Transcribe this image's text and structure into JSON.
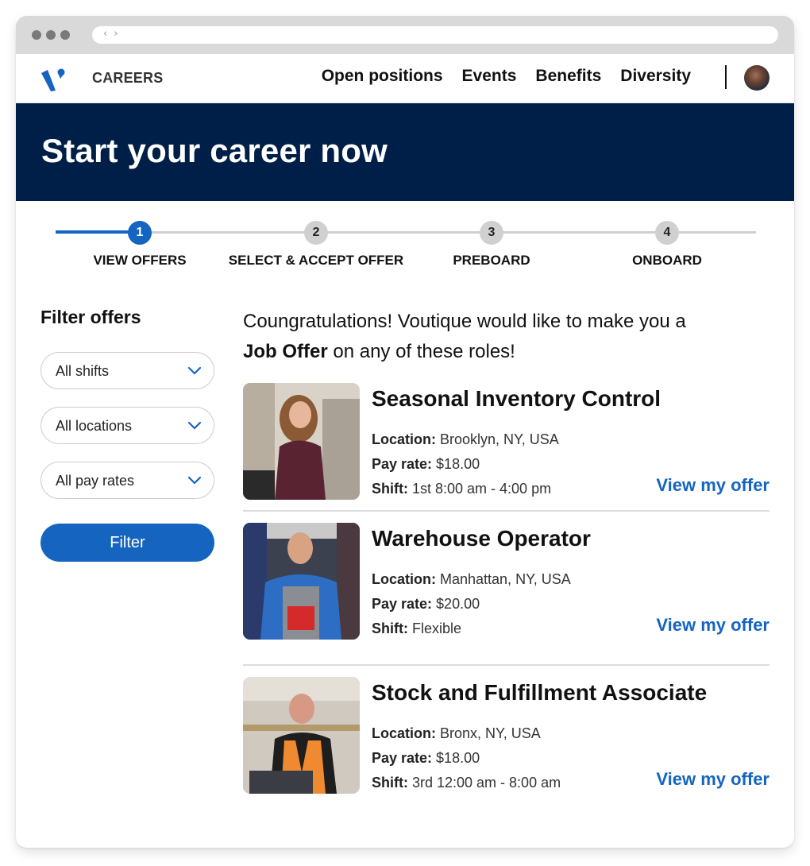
{
  "browser": {
    "nav_arrows": "‹ ›"
  },
  "header": {
    "brand": "CAREERS",
    "nav": [
      {
        "label": "Open positions"
      },
      {
        "label": "Events"
      },
      {
        "label": "Benefits"
      },
      {
        "label": "Diversity"
      }
    ],
    "avatar_icon": "user-avatar"
  },
  "hero": {
    "title": "Start your career now"
  },
  "stepper": {
    "current_step": 1,
    "steps": [
      {
        "number": "1",
        "label": "VIEW OFFERS"
      },
      {
        "number": "2",
        "label": "SELECT & ACCEPT OFFER"
      },
      {
        "number": "3",
        "label": "PREBOARD"
      },
      {
        "number": "4",
        "label": "ONBOARD"
      }
    ]
  },
  "filters": {
    "title": "Filter offers",
    "selects": [
      {
        "value": "All shifts"
      },
      {
        "value": "All locations"
      },
      {
        "value": "All pay rates"
      }
    ],
    "button_label": "Filter"
  },
  "intro": {
    "line1": "Coungratulations! Voutique would like to make you a",
    "bold": "Job Offer",
    "line2_rest": " on any of these roles!"
  },
  "offers": [
    {
      "title": "Seasonal Inventory Control",
      "location_label": "Location:",
      "location": " Brooklyn, NY, USA",
      "pay_label": "Pay rate:",
      "pay": " $18.00",
      "shift_label": "Shift:",
      "shift": " 1st 8:00 am - 4:00 pm",
      "link": "View my offer"
    },
    {
      "title": "Warehouse Operator",
      "location_label": "Location:",
      "location": " Manhattan, NY, USA",
      "pay_label": "Pay rate:",
      "pay": " $20.00",
      "shift_label": "Shift:",
      "shift": " Flexible",
      "link": "View my offer"
    },
    {
      "title": "Stock and Fulfillment Associate",
      "location_label": "Location:",
      "location": " Bronx, NY, USA",
      "pay_label": "Pay rate:",
      "pay": " $18.00",
      "shift_label": "Shift:",
      "shift": " 3rd 12:00 am - 8:00 am",
      "link": "View my offer"
    }
  ],
  "colors": {
    "primary": "#1565c0",
    "hero_bg": "#001f48",
    "step_inactive": "#d0d0d0"
  }
}
